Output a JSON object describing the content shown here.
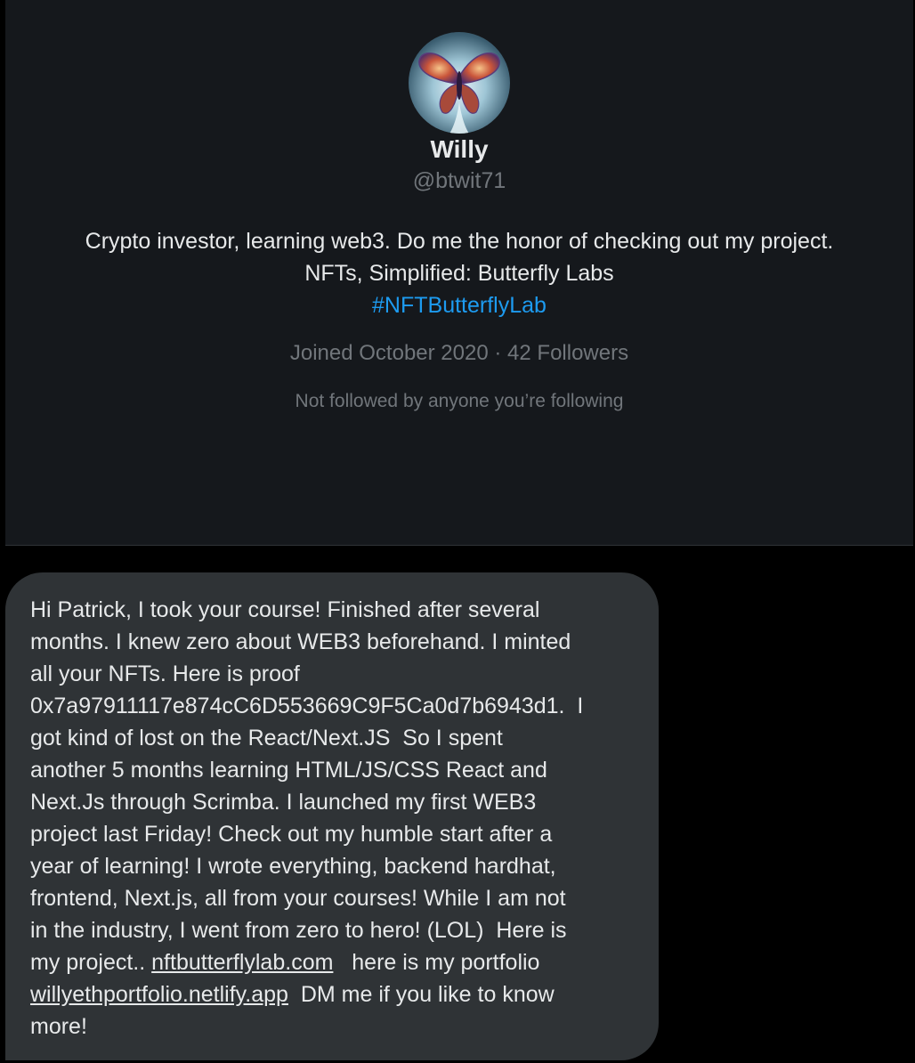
{
  "profile": {
    "name": "Willy",
    "handle": "@btwit71",
    "bio_lines": [
      "Crypto investor, learning web3.  Do me the honor of checking out my project.",
      "NFTs, Simplified: Butterfly Labs"
    ],
    "hashtag": "#NFTButterflyLab",
    "joined": "Joined October 2020",
    "separator": "·",
    "followers": "42 Followers",
    "followed_by": "Not followed by anyone you’re following",
    "avatar_icon": "butterfly-avatar-icon",
    "colors": {
      "card_bg": "#15181c",
      "link": "#1d9bf0",
      "secondary_text": "#71767b"
    }
  },
  "message": {
    "lines": [
      "Hi Patrick, I took your course! Finished after several",
      "months. I knew zero about WEB3 beforehand. I minted",
      "all your NFTs. Here is proof",
      "0x7a97911117e874cC6D553669C9F5Ca0d7b6943d1.  I",
      "got kind of lost on the React/Next.JS  So I spent",
      "another 5 months learning HTML/JS/CSS React and",
      "Next.Js through Scrimba. I launched my first WEB3",
      "project last Friday! Check out my humble start after a",
      "year of learning! I wrote everything, backend hardhat,",
      "frontend, Next.js, all from your courses! While I am not",
      "in the industry, I went from zero to hero! (LOL)  Here is"
    ],
    "line12_prefix": "my project.. ",
    "link1": "nftbutterflylab.com",
    "line12_suffix": "   here is my portfolio",
    "link2": "willyethportfolio.netlify.app",
    "line13_suffix": "  DM me if you like to know",
    "last_line": "more!",
    "colors": {
      "bubble_bg": "#2f3336"
    }
  }
}
